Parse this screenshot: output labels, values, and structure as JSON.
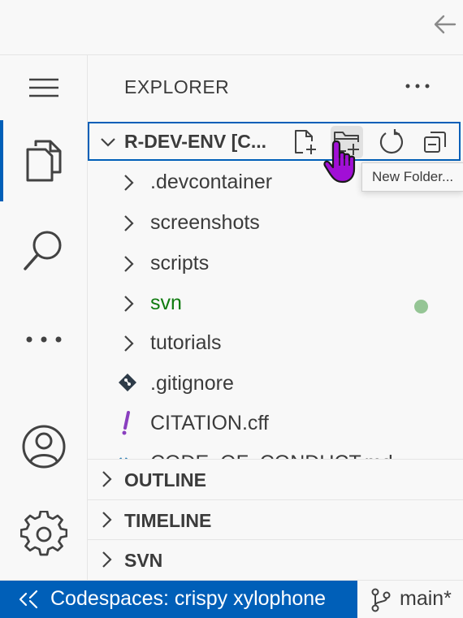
{
  "explorer": {
    "title": "EXPLORER",
    "root_label": "R-DEV-ENV [C...",
    "tree": [
      {
        "label": ".devcontainer",
        "kind": "folder"
      },
      {
        "label": "screenshots",
        "kind": "folder"
      },
      {
        "label": "scripts",
        "kind": "folder"
      },
      {
        "label": "svn",
        "kind": "folder",
        "status": "untracked"
      },
      {
        "label": "tutorials",
        "kind": "folder"
      },
      {
        "label": ".gitignore",
        "kind": "file",
        "icon": "git-icon"
      },
      {
        "label": "CITATION.cff",
        "kind": "file",
        "icon": "exclamation-icon"
      },
      {
        "label": "CODE_OF_CONDUCT.md",
        "kind": "file",
        "icon": "markdown-icon"
      }
    ]
  },
  "tooltip": {
    "text": "New Folder..."
  },
  "sections": {
    "outline": "OUTLINE",
    "timeline": "TIMELINE",
    "svn": "SVN"
  },
  "status": {
    "remote": "Codespaces: crispy xylophone",
    "branch": "main*"
  },
  "colors": {
    "accent": "#005fb8",
    "untracked": "#0f7b0f",
    "untracked_dot": "#95c595",
    "background": "#f8f8f8",
    "cursor": "#a10fd6"
  }
}
